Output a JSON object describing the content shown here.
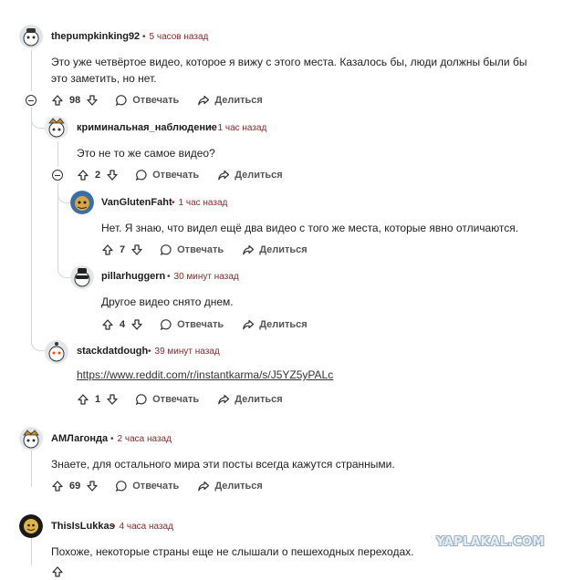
{
  "comments": [
    {
      "user": "thepumpkinking92",
      "time": "5 часов назад",
      "text": "Это уже четвёртое видео, которое я вижу с этого места. Казалось бы, люди должны были бы это заметить, но нет.",
      "votes": "98"
    },
    {
      "user": "криминальная_наблюдение",
      "time": "1 час назад",
      "text": "Это не то же самое видео?",
      "votes": "2"
    },
    {
      "user": "VanGlutenFaht",
      "time": "1 час назад",
      "text": "Нет. Я знаю, что видел ещё два видео с того же места, которые явно отличаются.",
      "votes": "7"
    },
    {
      "user": "pillarhuggern",
      "time": "30 минут назад",
      "text": "Другое видео снято днем.",
      "votes": "4"
    },
    {
      "user": "stackdatdough",
      "time": "39 минут назад",
      "text": "https://www.reddit.com/r/instantkarma/s/J5YZ5yPALc",
      "votes": "1"
    },
    {
      "user": "АМЛагонда",
      "time": "2 часа назад",
      "text": "Знаете, для остального мира эти посты всегда кажутся странными.",
      "votes": "69"
    },
    {
      "user": "ThisIsLukkas",
      "time": "4 часа назад",
      "text": "Похоже, некоторые страны еще не слышали о пешеходных переходах.",
      "votes": ""
    }
  ],
  "actions": {
    "reply": "Отвечать",
    "share": "Делиться"
  },
  "separator": "•",
  "watermark": "YAPLAKAL.COM",
  "icons": {
    "upvote": "arrow-up-icon",
    "downvote": "arrow-down-icon",
    "reply": "speech-bubble-icon",
    "share": "share-arrow-icon",
    "collapse": "collapse-minus-icon"
  }
}
